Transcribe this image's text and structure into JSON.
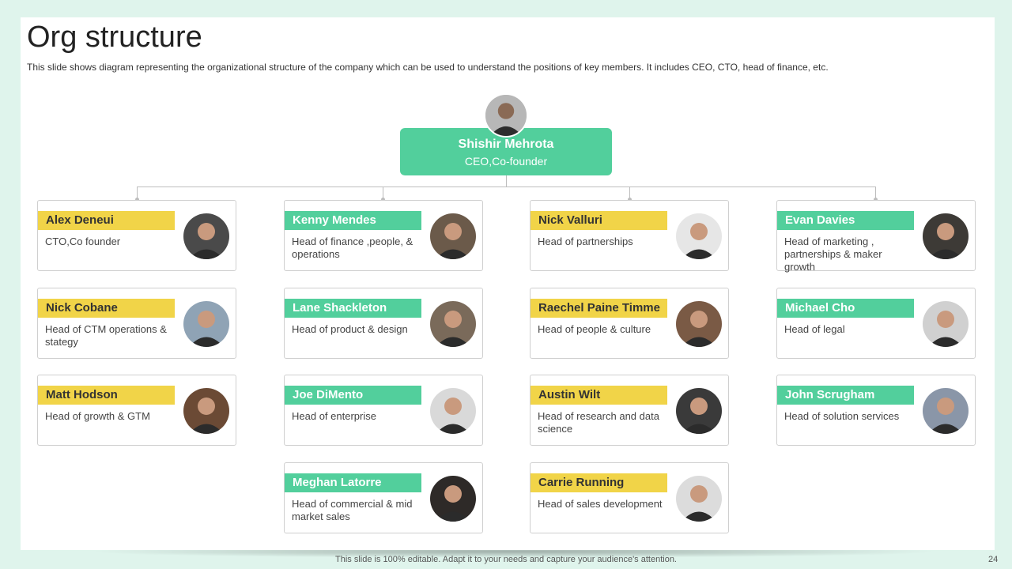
{
  "title": "Org structure",
  "subtitle": "This slide shows diagram representing the organizational structure of the company which can be used to understand the positions of key members. It includes CEO, CTO, head of finance, etc.",
  "ceo": {
    "name": "Shishir Mehrota",
    "role": "CEO,Co-founder",
    "photo_icon": "person-photo"
  },
  "cards": [
    {
      "name": "Alex Deneui",
      "role": "CTO,Co founder",
      "color": "yellow",
      "col": 0,
      "row": 0,
      "tone": "#4a4a4a"
    },
    {
      "name": "Nick Cobane",
      "role": "Head of CTM operations & stategy",
      "color": "yellow",
      "col": 0,
      "row": 1,
      "tone": "#8fa3b5"
    },
    {
      "name": "Matt Hodson",
      "role": "Head of growth & GTM",
      "color": "yellow",
      "col": 0,
      "row": 2,
      "tone": "#6b4a35"
    },
    {
      "name": "Kenny Mendes",
      "role": "Head of finance ,people, & operations",
      "color": "green",
      "col": 1,
      "row": 0,
      "tone": "#6b5a4a"
    },
    {
      "name": "Lane Shackleton",
      "role": "Head of product & design",
      "color": "green",
      "col": 1,
      "row": 1,
      "tone": "#7a6a5a"
    },
    {
      "name": "Joe DiMento",
      "role": "Head of enterprise",
      "color": "green",
      "col": 1,
      "row": 2,
      "tone": "#d9d9d9"
    },
    {
      "name": "Meghan Latorre",
      "role": "Head of commercial & mid market sales",
      "color": "green",
      "col": 1,
      "row": 3,
      "tone": "#2e2a28"
    },
    {
      "name": "Nick Valluri",
      "role": "Head of partnerships",
      "color": "yellow",
      "col": 2,
      "row": 0,
      "tone": "#e6e6e6"
    },
    {
      "name": "Raechel Paine Timme",
      "role": "Head of people & culture",
      "color": "yellow",
      "col": 2,
      "row": 1,
      "tone": "#7a5a45"
    },
    {
      "name": "Austin Wilt",
      "role": "Head of research and data science",
      "color": "yellow",
      "col": 2,
      "row": 2,
      "tone": "#3a3a3a"
    },
    {
      "name": "Carrie Running",
      "role": "Head of sales development",
      "color": "yellow",
      "col": 2,
      "row": 3,
      "tone": "#dcdcdc"
    },
    {
      "name": "Evan Davies",
      "role": "Head of marketing , partnerships & maker growth",
      "color": "green",
      "col": 3,
      "row": 0,
      "tone": "#3d3a36"
    },
    {
      "name": "Michael Cho",
      "role": "Head of legal",
      "color": "green",
      "col": 3,
      "row": 1,
      "tone": "#d0d0d0"
    },
    {
      "name": "John Scrugham",
      "role": "Head of solution services",
      "color": "green",
      "col": 3,
      "row": 2,
      "tone": "#8a96a8"
    }
  ],
  "footer": "This slide is 100% editable. Adapt it to your needs and capture your audience's attention.",
  "page_number": "24",
  "colors": {
    "green": "#52cf9c",
    "yellow": "#f1d448",
    "background": "#dff4ec"
  }
}
